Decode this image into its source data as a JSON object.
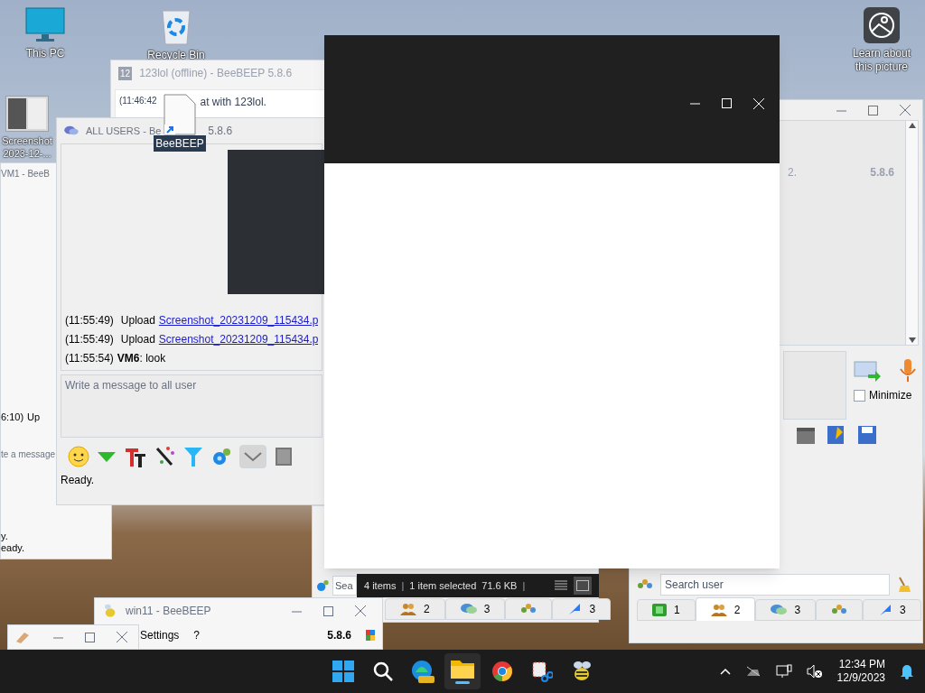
{
  "desktop_icons": [
    {
      "label": "This PC",
      "kind": "monitor"
    },
    {
      "label": "Recycle Bin",
      "kind": "bin"
    },
    {
      "label": "Screenshot 2023-12-...",
      "kind": "thumbnail"
    },
    {
      "label": "Learn about this picture",
      "kind": "picture"
    }
  ],
  "vm1_window": {
    "title": "VM1 - BeeB",
    "message_time": "6:10)",
    "message_text": "Up",
    "placeholder": "te a message",
    "status_lines": [
      "y.",
      "eady."
    ]
  },
  "chat_window": {
    "badge": "12",
    "title": "123lol (offline) - BeeBEEP 5.8.6",
    "messages": [
      {
        "time": "(11:46:42",
        "text": "at with 123lol."
      }
    ]
  },
  "all_users_window": {
    "title": "ALL USERS - Be",
    "title_version": "5.8.6",
    "messages": [
      {
        "kind": "upload",
        "time": "(11:55:49)",
        "action": "Upload",
        "link": "Screenshot_20231209_115434.p"
      },
      {
        "kind": "upload",
        "time": "(11:55:49)",
        "action": "Upload",
        "link": "Screenshot_20231209_115434.p"
      },
      {
        "kind": "text",
        "time": "(11:55:54)",
        "user": "VM6",
        "text": ": look"
      }
    ],
    "placeholder": "Write a message to all user",
    "status": "Ready."
  },
  "main_window": {
    "fragment": "2.",
    "version": "5.8.6",
    "minimize": {
      "label": "Minimize",
      "checked": false
    },
    "search_placeholder": "Search user",
    "tabs": [
      {
        "kind": "online",
        "count": "1",
        "selected": false
      },
      {
        "kind": "users",
        "count": "2",
        "selected": true
      },
      {
        "kind": "chats",
        "count": "3",
        "selected": false
      },
      {
        "kind": "groups",
        "selected": false
      },
      {
        "kind": "shares",
        "count": "3",
        "selected": false
      }
    ]
  },
  "middle_window": {
    "search_placeholder": "Sea",
    "tabs": [
      {
        "kind": "users",
        "count": "2",
        "selected": false
      },
      {
        "kind": "chats",
        "count": "3",
        "selected": false
      },
      {
        "kind": "groups",
        "selected": false
      },
      {
        "kind": "shares",
        "count": "3",
        "selected": false
      }
    ]
  },
  "explorer_status": {
    "items": "4 items",
    "separator_1": "|",
    "selection": "1 item selected",
    "size": "71.6 KB",
    "separator_2": "|",
    "views": [
      {
        "kind": "details",
        "selected": false
      },
      {
        "kind": "tiles",
        "selected": true
      }
    ]
  },
  "win11_window": {
    "title": "win11 - BeeBEEP",
    "menu": [
      "Settings",
      "?"
    ],
    "version": "5.8.6"
  },
  "dragged_icon": {
    "label": "BeeBEEP"
  },
  "taskbar": {
    "apps": [
      {
        "kind": "start",
        "active": false
      },
      {
        "kind": "search",
        "active": false
      },
      {
        "kind": "edge",
        "active": false
      },
      {
        "kind": "explorer",
        "active": true
      },
      {
        "kind": "chrome",
        "active": false
      },
      {
        "kind": "snip",
        "active": false
      },
      {
        "kind": "bee",
        "active": false
      }
    ],
    "time": "12:34 PM",
    "date": "12/9/2023"
  }
}
